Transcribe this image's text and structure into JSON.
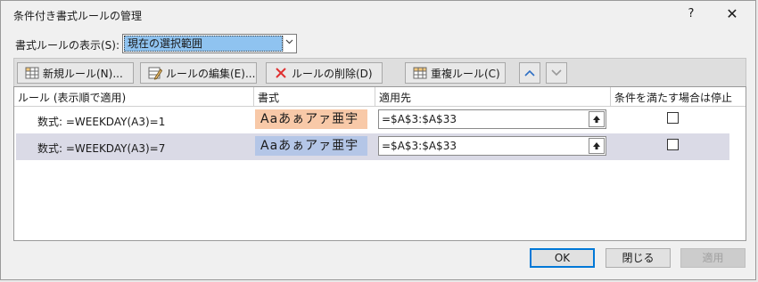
{
  "dialog": {
    "title": "条件付き書式ルールの管理",
    "help": "?",
    "close": "✕"
  },
  "scope": {
    "label": "書式ルールの表示(S):",
    "value": "現在の選択範囲",
    "arrow": "⌄"
  },
  "toolbar": {
    "new_rule": "新規ルール(N)...",
    "edit_rule": "ルールの編集(E)...",
    "delete_rule": "ルールの削除(D)",
    "duplicate_rule": "重複ルール(C)"
  },
  "grid": {
    "columns": [
      "ルール (表示順で適用)",
      "書式",
      "適用先",
      "条件を満たす場合は停止"
    ],
    "rows": [
      {
        "formula": "数式: =WEEKDAY(A3)=1",
        "preview": "Aaあぁアァ亜宇",
        "preview_bg": "#f8c9a8",
        "applies_to": "=$A$3:$A$33",
        "stop": false,
        "selected": false
      },
      {
        "formula": "数式: =WEEKDAY(A3)=7",
        "preview": "Aaあぁアァ亜宇",
        "preview_bg": "#b4c6e7",
        "applies_to": "=$A$3:$A$33",
        "stop": false,
        "selected": true
      }
    ]
  },
  "buttons": {
    "ok": "OK",
    "close": "閉じる",
    "apply": "適用"
  }
}
